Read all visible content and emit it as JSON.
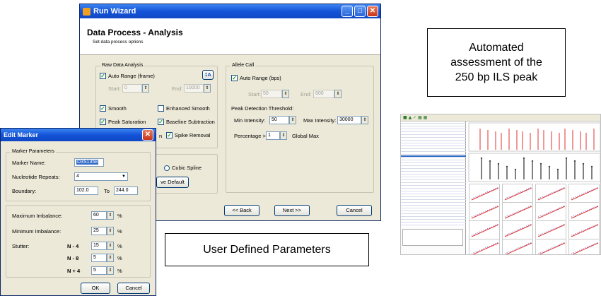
{
  "run_wizard": {
    "window_title": "Run Wizard",
    "heading": "Data Process - Analysis",
    "subheading": "Set data process options",
    "raw_data": {
      "group_label": "Raw Data Analysis",
      "auto_range": "Auto Range (frame)",
      "start_label": "Start:",
      "start_value": "0",
      "end_label": "End:",
      "end_value": "10000",
      "smooth": "Smooth",
      "enhanced_smooth": "Enhanced Smooth",
      "peak_saturation": "Peak Saturation",
      "baseline_subtraction": "Baseline Subtraction",
      "spike_partial": "n",
      "spike_removal": "Spike Removal",
      "cubic_spline": "Cubic Spline",
      "default_button": "ve Default"
    },
    "allele_call": {
      "group_label": "Allele Call",
      "auto_range": "Auto Range (bps)",
      "start_label": "Start:",
      "start_value": "50",
      "end_label": "End:",
      "end_value": "600",
      "threshold_label": "Peak Detection Threshold:",
      "min_intensity_label": "Min Intensity:",
      "min_intensity_value": "50",
      "max_intensity_label": "Max Intensity:",
      "max_intensity_value": "30000",
      "percentage_label": "Percentage >",
      "percentage_value": "1",
      "global_max": "Global Max"
    },
    "back_button": "<< Back",
    "next_button": "Next >>",
    "cancel_button": "Cancel"
  },
  "edit_marker": {
    "window_title": "Edit Marker",
    "group_label": "Marker Parameters",
    "marker_name_label": "Marker Name:",
    "marker_name_value": "D3S1358",
    "repeats_label": "Nucleotide Repeats:",
    "repeats_value": "4",
    "boundary_label": "Boundary:",
    "boundary_from": "102.0",
    "boundary_to_label": "To",
    "boundary_to": "244.0",
    "max_imbalance_label": "Maximum Imbalance:",
    "max_imbalance_value": "60",
    "min_imbalance_label": "Minimum Imbalance:",
    "min_imbalance_value": "25",
    "stutter_label": "Stutter:",
    "stutter_rows": [
      {
        "label": "N - 4",
        "value": "15"
      },
      {
        "label": "N - 8",
        "value": "5"
      },
      {
        "label": "N + 4",
        "value": "5"
      }
    ],
    "unit": "%",
    "ok_button": "OK",
    "cancel_button": "Cancel"
  },
  "callouts": {
    "ils_lines": [
      "Automated",
      "assessment of the",
      "250 bp ILS peak"
    ],
    "user_defined": "User Defined Parameters"
  },
  "colors": {
    "titlebar": "#0f48c4",
    "window_bg": "#ece9d8",
    "trace_red": "#e03030",
    "trace_black": "#000000"
  }
}
